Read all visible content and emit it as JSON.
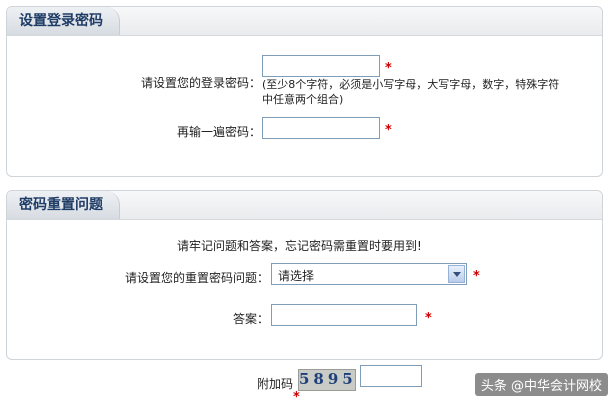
{
  "login_password_section": {
    "title": "设置登录密码",
    "password_label": "请设置您的登录密码：",
    "password_hint": "(至少8个字符，必须是小写字母，大写字母，数字，特殊字符中任意两个组合)",
    "confirm_label": "再输一遍密码：",
    "required_mark": "*"
  },
  "reset_question_section": {
    "title": "密码重置问题",
    "notice": "请牢记问题和答案，忘记密码需重置时要用到!",
    "question_label": "请设置您的重置密码问题：",
    "question_selected": "请选择",
    "answer_label": "答案：",
    "required_mark": "*"
  },
  "verification": {
    "label": "附加码",
    "captcha_text": "5895",
    "required_mark": "*"
  },
  "watermark": "头条 @中华会计网校"
}
